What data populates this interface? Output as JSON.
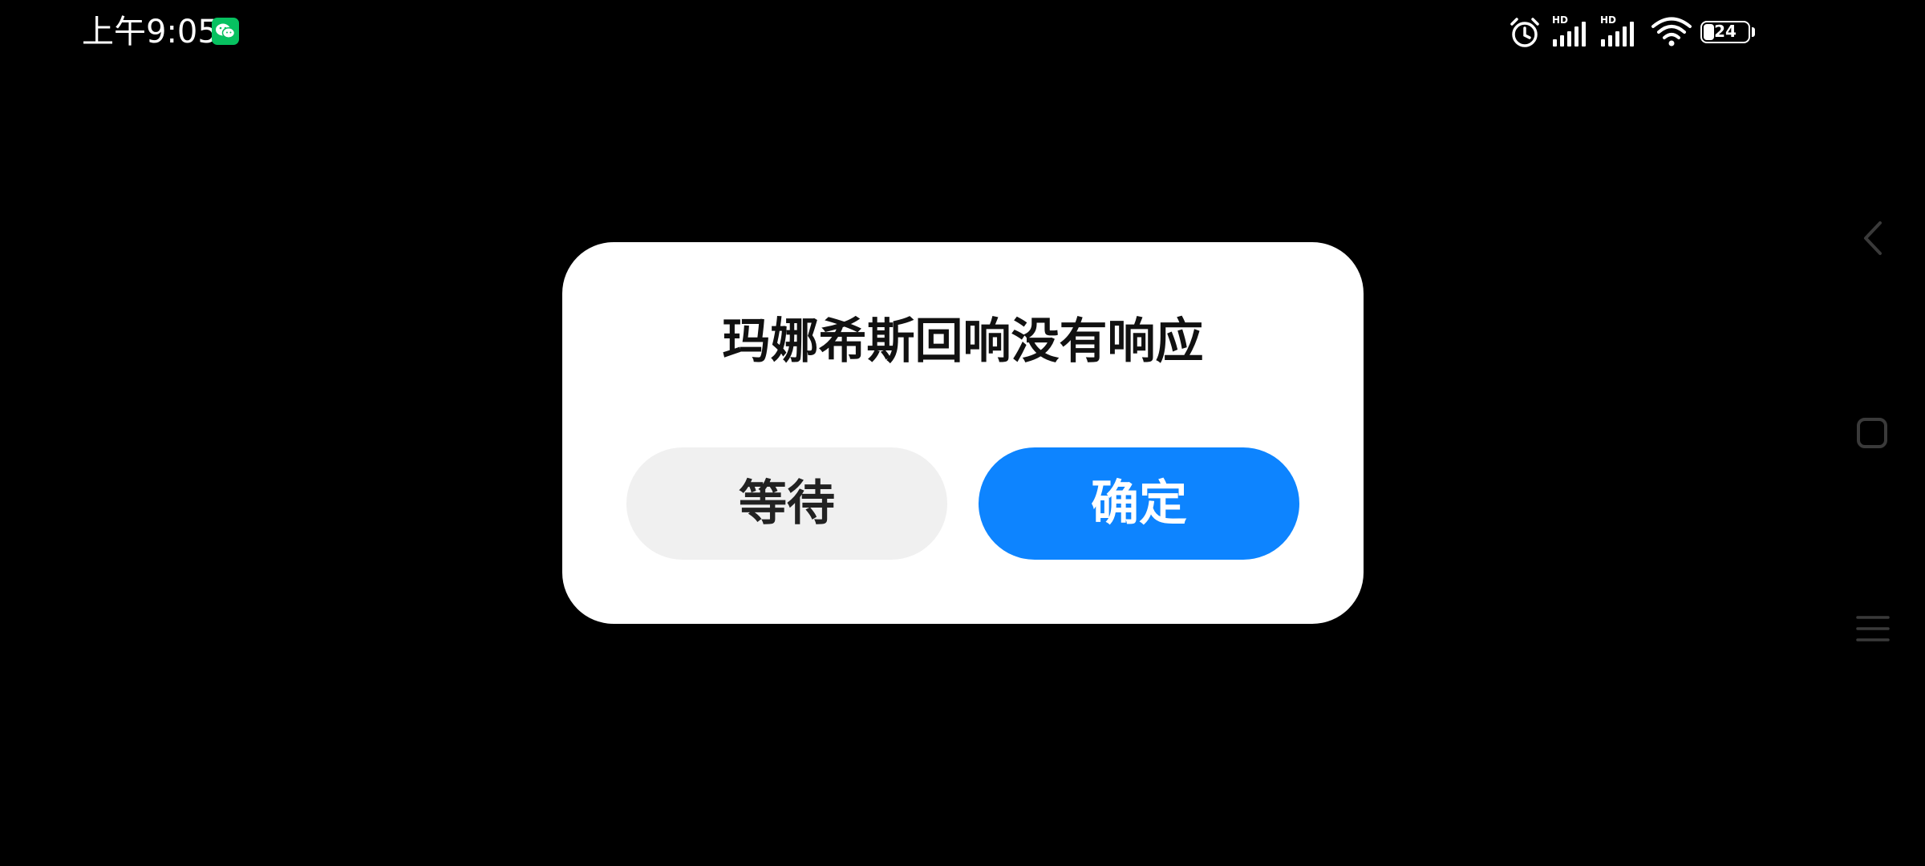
{
  "status_bar": {
    "time": "上午9:05",
    "notification_icon": "wechat-icon",
    "signal_1_label": "HD",
    "signal_2_label": "HD",
    "wifi_icon": "wifi-icon",
    "alarm_icon": "alarm-icon",
    "battery_level": "24",
    "battery_percent": 24
  },
  "dialog": {
    "title": "玛娜希斯回响没有响应",
    "wait_button": "等待",
    "ok_button": "确定"
  },
  "navigation": {
    "back_icon": "chevron-left-icon",
    "home_icon": "square-icon",
    "menu_icon": "menu-icon"
  },
  "colors": {
    "background": "#000000",
    "dialog_background": "#ffffff",
    "primary_button": "#0d84ff",
    "secondary_button": "#f0f0f0",
    "wechat": "#07c160"
  }
}
